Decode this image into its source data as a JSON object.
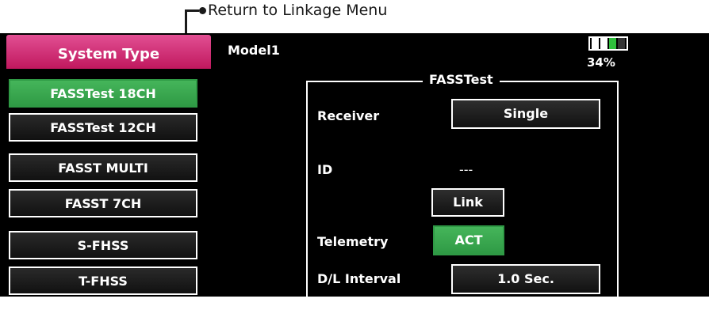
{
  "annotation": {
    "text": "Return to Linkage Menu"
  },
  "header": {
    "tab_title": "System Type",
    "model_name": "Model1",
    "battery_percent": "34%",
    "battery_level": 0.8,
    "battery_color": "#2fbf3c"
  },
  "sidebar": {
    "items": [
      {
        "label": "FASSTest 18CH",
        "selected": true
      },
      {
        "label": "FASSTest 12CH",
        "selected": false
      },
      {
        "label": "FASST MULTI",
        "selected": false
      },
      {
        "label": "FASST 7CH",
        "selected": false
      },
      {
        "label": "S-FHSS",
        "selected": false
      },
      {
        "label": "T-FHSS",
        "selected": false
      }
    ]
  },
  "panel": {
    "title": "FASSTest",
    "receiver_label": "Receiver",
    "receiver_value": "Single",
    "id_label": "ID",
    "id_value": "---",
    "link_button": "Link",
    "telemetry_label": "Telemetry",
    "telemetry_value": "ACT",
    "dl_interval_label": "D/L Interval",
    "dl_interval_value": "1.0 Sec."
  },
  "colors": {
    "tab_accent": "#d22d78",
    "selected_green": "#3aa84f",
    "screen_bg": "#000000"
  }
}
